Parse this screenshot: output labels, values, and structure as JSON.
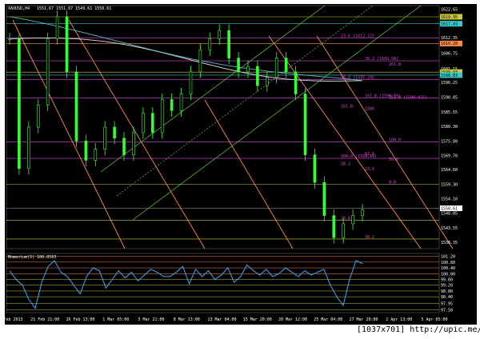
{
  "header": {
    "symbol": "XAUUSD,H4",
    "ohlc": "1551.67 1551.67 1549.61 1550.61"
  },
  "footer": {
    "watermark": "[1037x701] http://upic.me/"
  },
  "colors": {
    "background": "#000000",
    "candles": "#33ff33",
    "momentum": "#33aaff",
    "fib_red": "#ff8844",
    "fib_violet": "#dd44dd",
    "channel_green": "#66cc33",
    "level_yellow": "#cccc33",
    "level_cyan": "#33cccc",
    "ma_white": "#e0e0e0",
    "ma_cyan": "#55bbcc"
  },
  "chart_data": [
    {
      "type": "candlestick",
      "symbol": "XAUUSD",
      "timeframe": "H4",
      "x": [
        "19 Feb 2013",
        "21 Feb 21:00",
        "26 Feb 13:00",
        "1 Mar 05:00",
        "5 Mar 21:00",
        "8 Mar 13:00",
        "13 Mar 04:00",
        "15 Mar 20:00",
        "20 Mar 12:00",
        "25 Mar 04:00",
        "27 Mar 20:00",
        "2 Apr 13:00",
        "5 Apr 05:00"
      ],
      "close_path": [
        [
          0,
          1612
        ],
        [
          2,
          1565
        ],
        [
          3,
          1580
        ],
        [
          5,
          1588
        ],
        [
          7,
          1612
        ],
        [
          8,
          1620
        ],
        [
          9,
          1600
        ],
        [
          10,
          1575
        ],
        [
          11,
          1568
        ],
        [
          12,
          1572
        ],
        [
          13,
          1580
        ],
        [
          14,
          1576
        ],
        [
          15,
          1570
        ],
        [
          16,
          1578
        ],
        [
          17,
          1585
        ],
        [
          18,
          1578
        ],
        [
          19,
          1590
        ],
        [
          20,
          1586
        ],
        [
          21,
          1592
        ],
        [
          22,
          1600
        ],
        [
          23,
          1608
        ],
        [
          24,
          1612
        ],
        [
          25,
          1615
        ],
        [
          26,
          1605
        ],
        [
          27,
          1600
        ],
        [
          28,
          1602
        ],
        [
          29,
          1595
        ],
        [
          30,
          1598
        ],
        [
          31,
          1605
        ],
        [
          32,
          1600
        ],
        [
          33,
          1592
        ],
        [
          34,
          1570
        ],
        [
          35,
          1560
        ],
        [
          36,
          1548
        ],
        [
          37,
          1540
        ],
        [
          38,
          1545
        ],
        [
          39,
          1548
        ],
        [
          40,
          1550
        ]
      ],
      "y_ticks": [
        "1622.65",
        "1617.90",
        "1612.35",
        "1606.75",
        "1601.15",
        "1596.25",
        "1590.85",
        "1585.55",
        "1580.30",
        "1575.00",
        "1569.70",
        "1564.60",
        "1559.30",
        "1554.10",
        "1548.85",
        "1543.55",
        "1538.35"
      ],
      "ylim": [
        1536,
        1624
      ],
      "price_labels": [
        {
          "text": "1619.95",
          "value": 1619.95,
          "color": "#cccc33"
        },
        {
          "text": "1617.43",
          "value": 1617.43,
          "color": "#33cccc"
        },
        {
          "text": "1610.28",
          "value": 1610.28,
          "color": "#ff8844"
        },
        {
          "text": "1599.93",
          "value": 1599.93,
          "color": "#cccc33"
        },
        {
          "text": "1598.83",
          "value": 1598.83,
          "color": "#33cccc"
        },
        {
          "text": "1550.61",
          "value": 1550.61,
          "color": "#ffffff"
        }
      ],
      "fib_levels": [
        {
          "label": "23.6 (1612.32)",
          "value": 1612.3
        },
        {
          "label": "38.2 (1603.98)",
          "value": 1604.0
        },
        {
          "label": "261.8",
          "value": 1602.0
        },
        {
          "label": "50.0 (1597.24)",
          "value": 1597.2
        },
        {
          "label": "161.8 (1590.50)",
          "value": 1590.5
        },
        {
          "label": "161.8 (1590.025)",
          "value": 1590.0
        },
        {
          "label": "161.8",
          "value": 1586.8
        },
        {
          "label": "1586",
          "value": 1586.0
        },
        {
          "label": "100.0",
          "value": 1574.6
        },
        {
          "label": "100.0 (1568.69)",
          "value": 1568.7
        },
        {
          "label": "61.8",
          "value": 1569.6
        },
        {
          "label": "50.0",
          "value": 1567.5
        },
        {
          "label": "38.2",
          "value": 1565.9
        },
        {
          "label": "23.6",
          "value": 1564.1
        },
        {
          "label": "0.0",
          "value": 1559.3
        },
        {
          "label": "23.6",
          "value": 1546.3
        },
        {
          "label": "38.2",
          "value": 1539.5
        }
      ]
    },
    {
      "type": "line",
      "indicator": "Momentum(5) 100.0593",
      "y_ticks": [
        "101.20",
        "100.80",
        "100.40",
        "100.00",
        "99.60",
        "99.20",
        "98.80",
        "98.40",
        "97.95",
        "97.50"
      ],
      "ylim": [
        97.3,
        101.4
      ],
      "values": [
        100.2,
        99.6,
        99.2,
        98.2,
        97.6,
        99.4,
        100.5,
        100.9,
        100.1,
        99.8,
        99.2,
        98.6,
        99.8,
        100.4,
        100.2,
        99.0,
        99.6,
        100.2,
        99.7,
        100.1,
        99.5,
        99.9,
        100.3,
        100.1,
        99.8,
        99.8,
        100.1,
        100.5,
        99.3,
        100.3,
        99.8,
        100.2,
        99.6,
        99.9,
        100.4,
        99.4,
        99.8,
        100.6,
        100.2,
        99.9,
        100.3,
        99.8,
        100.0,
        100.4,
        100.1,
        99.8,
        100.2,
        99.9,
        100.1,
        100.3,
        99.2,
        98.4,
        97.8,
        99.6,
        100.9,
        100.7
      ]
    }
  ]
}
